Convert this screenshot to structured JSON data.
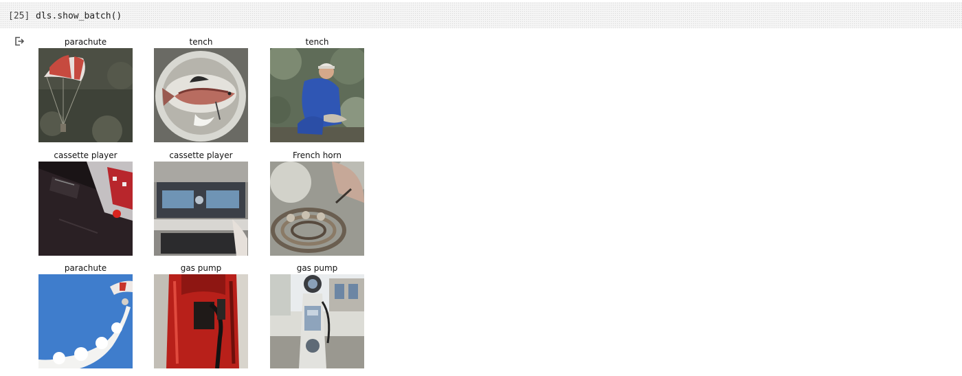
{
  "cell": {
    "execution_count": "[25]",
    "code": "dls.show_batch()"
  },
  "output": {
    "icon": "output-redirect-icon",
    "items": [
      {
        "label": "parachute"
      },
      {
        "label": "tench"
      },
      {
        "label": "tench"
      },
      {
        "label": "cassette player"
      },
      {
        "label": "cassette player"
      },
      {
        "label": "French horn"
      },
      {
        "label": "parachute"
      },
      {
        "label": "gas pump"
      },
      {
        "label": "gas pump"
      }
    ]
  }
}
